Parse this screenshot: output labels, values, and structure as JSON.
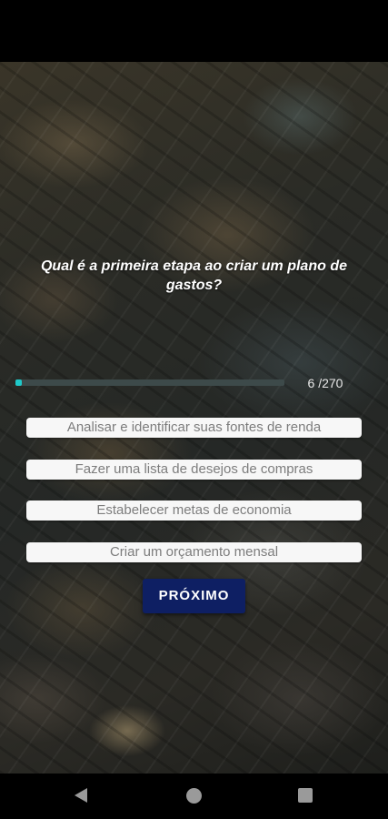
{
  "quiz": {
    "question": "Qual é a primeira etapa ao criar um plano de gastos?",
    "progress": {
      "current": 6,
      "total": 270,
      "label": "6 /270"
    },
    "options": [
      {
        "label": "Analisar e identificar suas fontes de renda"
      },
      {
        "label": "Fazer uma lista de desejos de compras"
      },
      {
        "label": "Estabelecer metas de economia"
      },
      {
        "label": "Criar um orçamento mensal"
      }
    ],
    "next_button": "PRÓXIMO"
  },
  "colors": {
    "progress_fill": "#1fc9c9",
    "progress_track": "#3d4a4a",
    "button_bg": "#0e1f63",
    "option_bg": "#f7f7f7",
    "option_text": "#7d7d7d"
  },
  "nav_icons": [
    "back-icon",
    "home-icon",
    "recents-icon"
  ]
}
